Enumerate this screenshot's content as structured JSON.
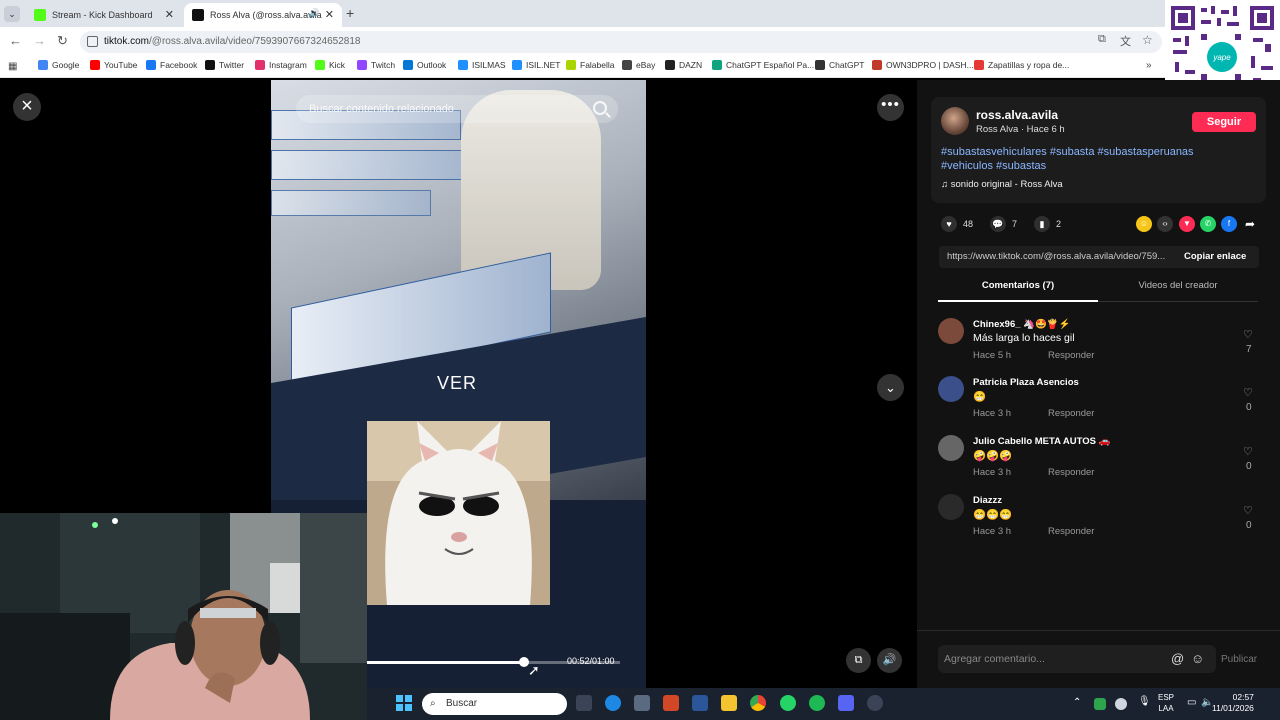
{
  "browser": {
    "tabs": [
      {
        "label": "Stream - Kick Dashboard",
        "fav_color": "#53fc18"
      },
      {
        "label": "Ross Alva (@ross.alva.avila",
        "fav_color": "#111111"
      }
    ],
    "url_host": "tiktok.com",
    "url_path": "/@ross.alva.avila/video/7593907667324652818",
    "bookmarks": [
      {
        "label": "Google",
        "color": "#4285f4"
      },
      {
        "label": "YouTube",
        "color": "#ff0000"
      },
      {
        "label": "Facebook",
        "color": "#1877f2"
      },
      {
        "label": "Twitter",
        "color": "#111111"
      },
      {
        "label": "Instagram",
        "color": "#e1306c"
      },
      {
        "label": "Kick",
        "color": "#53fc18"
      },
      {
        "label": "Twitch",
        "color": "#9146ff"
      },
      {
        "label": "Outlook",
        "color": "#0078d4"
      },
      {
        "label": "ISILMAS",
        "color": "#1e90ff"
      },
      {
        "label": "ISIL.NET",
        "color": "#1e90ff"
      },
      {
        "label": "Falabella",
        "color": "#aad500"
      },
      {
        "label": "eBay",
        "color": "#444444"
      },
      {
        "label": "DAZN",
        "color": "#222222"
      },
      {
        "label": "ChatGPT Español Pa...",
        "color": "#10a37f"
      },
      {
        "label": "ChatGPT",
        "color": "#333333"
      },
      {
        "label": "OWN3DPRO | DASH...",
        "color": "#c0392b"
      },
      {
        "label": "Zapatillas y ropa de...",
        "color": "#e53935"
      }
    ]
  },
  "video": {
    "search_placeholder": "Buscar contenido relacionado",
    "overlay_text": "VER",
    "time": "00:52/01:00",
    "progress": 0.62
  },
  "post": {
    "username": "ross.alva.avila",
    "subline": "Ross Alva · Hace 6 h",
    "follow_label": "Seguir",
    "hashtags": "#subastasvehiculares #subasta #subastasperuanas #vehiculos #subastas",
    "music": "sonido original - Ross Alva",
    "likes": "48",
    "comments": "7",
    "saves": "2",
    "link": "https://www.tiktok.com/@ross.alva.avila/video/759...",
    "copy_label": "Copiar enlace",
    "tab_comments": "Comentarios (7)",
    "tab_videos": "Videos del creador"
  },
  "comments": [
    {
      "name": "Chinex96_ 🦄🤩🍟⚡",
      "text": "Más larga lo haces gil",
      "meta": "Hace 5 h",
      "reply": "Responder",
      "likes": "7",
      "avatar_color": "#7b4a3a"
    },
    {
      "name": "Patricia Plaza Asencios",
      "text": "😁",
      "meta": "Hace 3 h",
      "reply": "Responder",
      "likes": "0",
      "avatar_color": "#3b4f8a"
    },
    {
      "name": "Julio Cabello META AUTOS 🚗",
      "text": "🤪🤪🤪",
      "meta": "Hace 3 h",
      "reply": "Responder",
      "likes": "0",
      "avatar_color": "#666666"
    },
    {
      "name": "Diazzz",
      "text": "😁😁😁",
      "meta": "Hace 3 h",
      "reply": "Responder",
      "likes": "0",
      "avatar_color": "#2a2a2a"
    }
  ],
  "composer": {
    "placeholder": "Agregar comentario...",
    "publish_label": "Publicar"
  },
  "taskbar": {
    "search_label": "Buscar",
    "lang_top": "ESP",
    "lang_bottom": "LAA",
    "time": "02:57",
    "date": "11/01/2026"
  },
  "colors": {
    "accent": "#fe2c55",
    "hashtag": "#8ab6ff",
    "panel_bg": "#121212"
  }
}
